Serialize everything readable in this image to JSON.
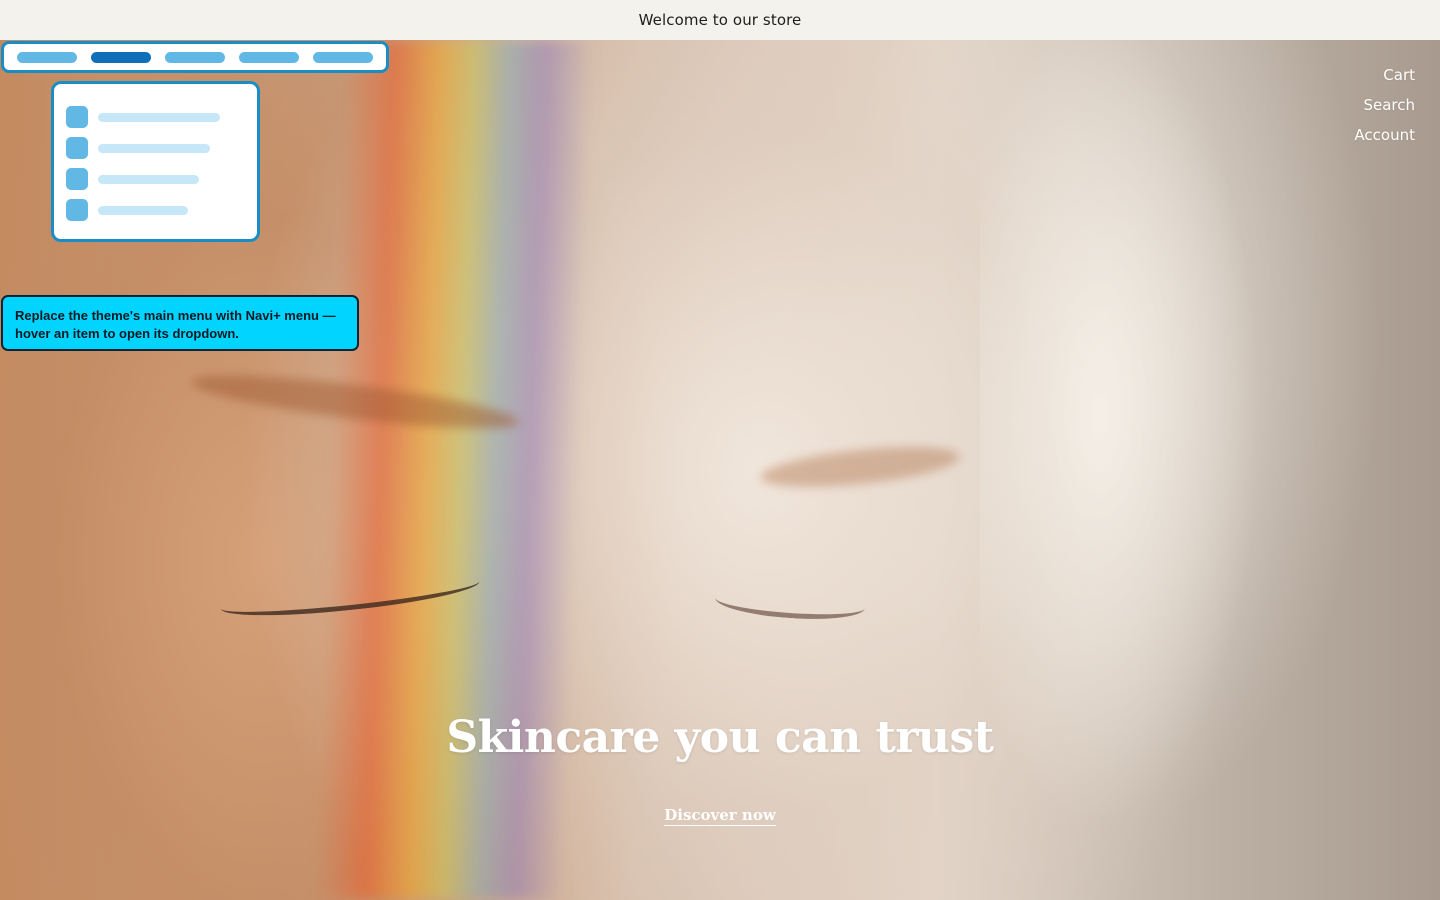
{
  "announcement": {
    "text": "Welcome to our store"
  },
  "header": {
    "links": [
      {
        "label": "Cart"
      },
      {
        "label": "Search"
      },
      {
        "label": "Account"
      }
    ]
  },
  "hero": {
    "title": "Skincare you can trust",
    "cta_label": "Discover now"
  },
  "navi_illustration": {
    "menu_items": 5,
    "active_item": 2,
    "dropdown_items": 4,
    "colors": {
      "border": "#1a8dc4",
      "pill": "#62b8e4",
      "pill_active": "#0f6fb8",
      "line": "#c5e7f7"
    }
  },
  "callout": {
    "text": "Replace the theme's main menu with Navi+ menu — hover an item to open its dropdown.",
    "color": "#00d4ff"
  }
}
